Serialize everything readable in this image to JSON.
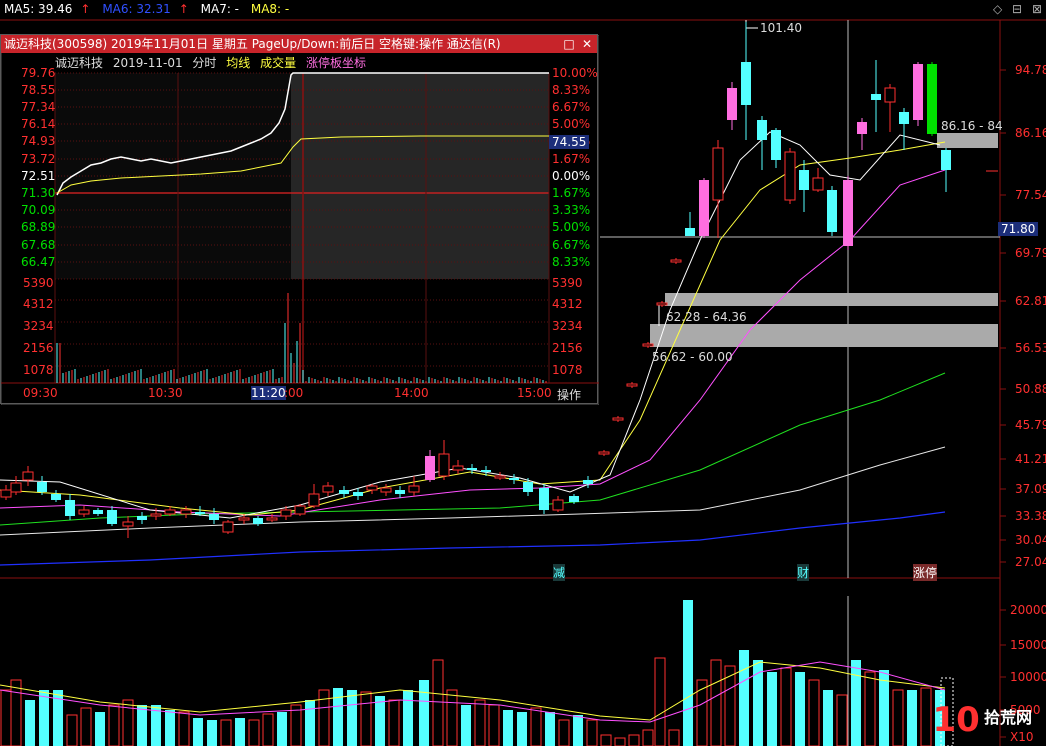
{
  "ma_bar": {
    "ma5": "MA5: 39.46",
    "ma6": "MA6: 32.31",
    "ma7": "MA7: -",
    "ma8": "MA8: -"
  },
  "top_icons": [
    "◇",
    "⊟",
    "⊠"
  ],
  "price_axis": [
    "94.78",
    "86.16",
    "77.54",
    "69.79",
    "62.81",
    "56.53",
    "50.88",
    "45.79",
    "41.21",
    "37.09",
    "33.38",
    "30.04",
    "27.04"
  ],
  "price_tag": "71.80",
  "volume_axis": [
    "20000",
    "15000",
    "10000",
    "5000",
    "X10"
  ],
  "annotations": {
    "peak": "101.40",
    "gap1": "86.16 - 84",
    "gap2": "62.28 - 64.36",
    "gap3": "56.62 - 60.00"
  },
  "markers": {
    "m1": "减",
    "m2": "财",
    "m3": "涨停"
  },
  "popup": {
    "title": "诚迈科技(300598) 2019年11月01日 星期五 PageUp/Down:前后日 空格键:操作 通达信(R)",
    "btn_min": "□",
    "btn_close": "✕",
    "info": {
      "name": "诚迈科技",
      "date": "2019-11-01",
      "mode": "分时",
      "avg": "均线",
      "vol": "成交量",
      "limit": "涨停板坐标"
    },
    "left_prices": [
      "79.76",
      "78.55",
      "77.34",
      "76.14",
      "74.93",
      "73.72",
      "72.51",
      "71.30",
      "70.09",
      "68.89",
      "67.68",
      "66.47"
    ],
    "right_pcts": [
      "10.00%",
      "8.33%",
      "6.67%",
      "5.00%",
      "3.33%",
      "1.67%",
      "0.00%",
      "1.67%",
      "3.33%",
      "5.00%",
      "6.67%",
      "8.33%"
    ],
    "price_tag": "74.55",
    "left_vols": [
      "5390",
      "4312",
      "3234",
      "2156",
      "1078"
    ],
    "right_vols": [
      "5390",
      "4312",
      "3234",
      "2156",
      "1078"
    ],
    "times": [
      "09:30",
      "10:30",
      "11:20",
      "14:00",
      "15:00"
    ],
    "time_suffix": ":00",
    "operate": "操作"
  },
  "logo": "拾荒网",
  "colors": {
    "up": "#ff3030",
    "down": "#54ffff",
    "titlebar": "#c7242a",
    "pink": "#ff6ee0",
    "green": "#00e000"
  }
}
